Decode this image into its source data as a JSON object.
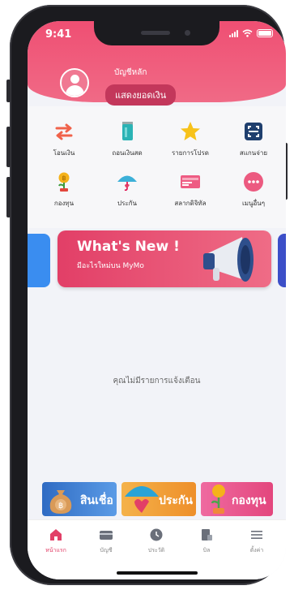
{
  "status": {
    "time": "9:41"
  },
  "profile": {
    "account_name": "บัญชีหลัก",
    "show_balance": "แสดงยอดเงิน"
  },
  "menu": [
    {
      "label": "โอนเงิน",
      "icon": "transfer-icon"
    },
    {
      "label": "ถอนเงินสด",
      "icon": "withdraw-icon"
    },
    {
      "label": "รายการโปรด",
      "icon": "star-icon"
    },
    {
      "label": "สแกนจ่าย",
      "icon": "scan-icon"
    },
    {
      "label": "กองทุน",
      "icon": "fund-icon"
    },
    {
      "label": "ประกัน",
      "icon": "umbrella-icon"
    },
    {
      "label": "สลากดิจิทัล",
      "icon": "lottery-icon"
    },
    {
      "label": "เมนูอื่นๆ",
      "icon": "more-icon"
    }
  ],
  "promo": {
    "title": "What's New !",
    "subtitle": "มีอะไรใหม่บน MyMo",
    "icon": "megaphone-icon"
  },
  "empty_message": "คุณไม่มีรายการแจ้งเตือน",
  "banners": [
    {
      "label": "สินเชื่อ",
      "color": "#3a76c9",
      "icon": "money-bag-icon"
    },
    {
      "label": "ประกัน",
      "color": "#f2a33a",
      "icon": "umbrella-icon"
    },
    {
      "label": "กองทุน",
      "color": "#e74e86",
      "icon": "fund-icon"
    }
  ],
  "tabs": [
    {
      "label": "หน้าแรก",
      "icon": "home-icon",
      "active": true
    },
    {
      "label": "บัญชี",
      "icon": "card-icon",
      "active": false
    },
    {
      "label": "ประวัติ",
      "icon": "clock-icon",
      "active": false
    },
    {
      "label": "บิล",
      "icon": "bill-icon",
      "active": false
    },
    {
      "label": "ตั้งค่า",
      "icon": "menu-icon",
      "active": false
    }
  ],
  "colors": {
    "brand": "#e23f67",
    "header": "#ef4f73"
  }
}
